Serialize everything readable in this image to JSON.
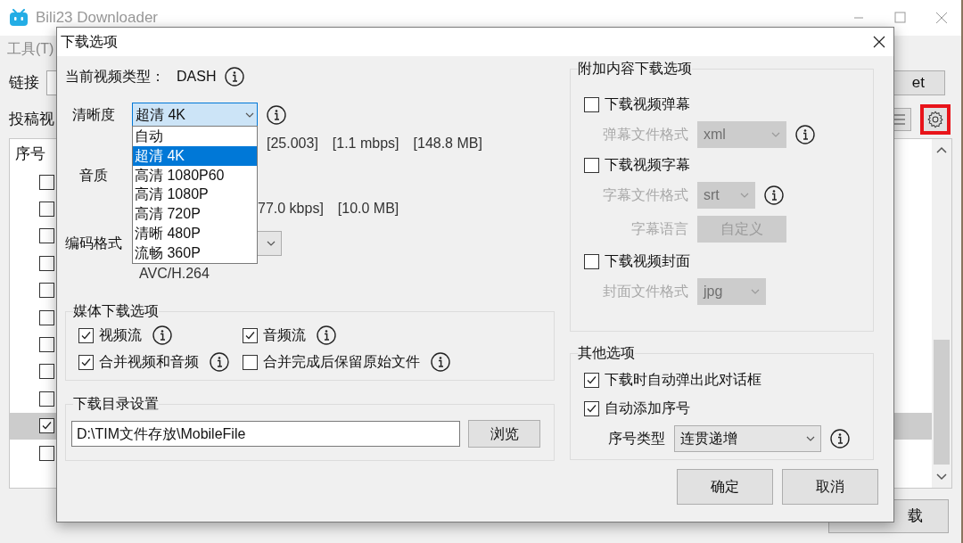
{
  "main_window": {
    "title": "Bili23 Downloader",
    "menu": [
      "工具(T)"
    ],
    "link_label": "链接",
    "section_label": "投稿视",
    "top_button": "et",
    "settings_highlighted": true,
    "bottom_button": "载",
    "list": {
      "columns": [
        "序号"
      ],
      "rows": [
        {
          "checked": false,
          "selected": false
        },
        {
          "checked": false,
          "selected": false
        },
        {
          "checked": false,
          "selected": false
        },
        {
          "checked": false,
          "selected": false
        },
        {
          "checked": false,
          "selected": false
        },
        {
          "checked": false,
          "selected": false
        },
        {
          "checked": false,
          "selected": false
        },
        {
          "checked": false,
          "selected": false
        },
        {
          "checked": false,
          "selected": false
        },
        {
          "checked": true,
          "selected": true
        },
        {
          "checked": false,
          "selected": false
        }
      ]
    }
  },
  "dialog": {
    "title": "下载选项",
    "video_type_label": "当前视频类型：",
    "video_type": "DASH",
    "quality": {
      "label": "清晰度",
      "value": "超清 4K",
      "expanded": true,
      "info": [
        "[25.003]",
        "[1.1 mbps]",
        "[148.8 MB]"
      ],
      "options": [
        {
          "label": "自动",
          "selected": false
        },
        {
          "label": "超清 4K",
          "selected": true
        },
        {
          "label": "高清 1080P60",
          "selected": false
        },
        {
          "label": "高清 1080P",
          "selected": false
        },
        {
          "label": "高清 720P",
          "selected": false
        },
        {
          "label": "清晰 480P",
          "selected": false
        },
        {
          "label": "流畅 360P",
          "selected": false
        }
      ]
    },
    "audio": {
      "label": "音质",
      "info": [
        "77.0 kbps]",
        "[10.0 MB]"
      ]
    },
    "codec": {
      "label": "编码格式",
      "note": "AVC/H.264"
    },
    "media_options": {
      "title": "媒体下载选项",
      "items": [
        {
          "label": "视频流",
          "checked": true
        },
        {
          "label": "音频流",
          "checked": true
        },
        {
          "label": "合并视频和音频",
          "checked": true
        },
        {
          "label": "合并完成后保留原始文件",
          "checked": false
        }
      ]
    },
    "directory": {
      "title": "下载目录设置",
      "value": "D:\\TIM文件存放\\MobileFile",
      "button": "浏览"
    },
    "extra_options": {
      "title": "附加内容下载选项",
      "items": [
        {
          "kind": "checkbox",
          "label": "下载视频弹幕",
          "checked": false
        },
        {
          "kind": "select",
          "label": "弹幕文件格式",
          "value": "xml",
          "disabled": true,
          "info": true
        },
        {
          "kind": "checkbox",
          "label": "下载视频字幕",
          "checked": false
        },
        {
          "kind": "select",
          "label": "字幕文件格式",
          "value": "srt",
          "disabled": true,
          "info": true
        },
        {
          "kind": "button",
          "label": "字幕语言",
          "value": "自定义",
          "disabled": true
        },
        {
          "kind": "checkbox",
          "label": "下载视频封面",
          "checked": false
        },
        {
          "kind": "select",
          "label": "封面文件格式",
          "value": "jpg",
          "disabled": true,
          "info": false
        }
      ]
    },
    "other_options": {
      "title": "其他选项",
      "items": [
        {
          "kind": "checkbox",
          "label": "下载时自动弹出此对话框",
          "checked": true
        },
        {
          "kind": "checkbox",
          "label": "自动添加序号",
          "checked": true
        },
        {
          "kind": "select",
          "label": "序号类型",
          "value": "连贯递增",
          "disabled": false,
          "info": true
        }
      ]
    },
    "buttons": [
      "确定",
      "取消"
    ]
  }
}
